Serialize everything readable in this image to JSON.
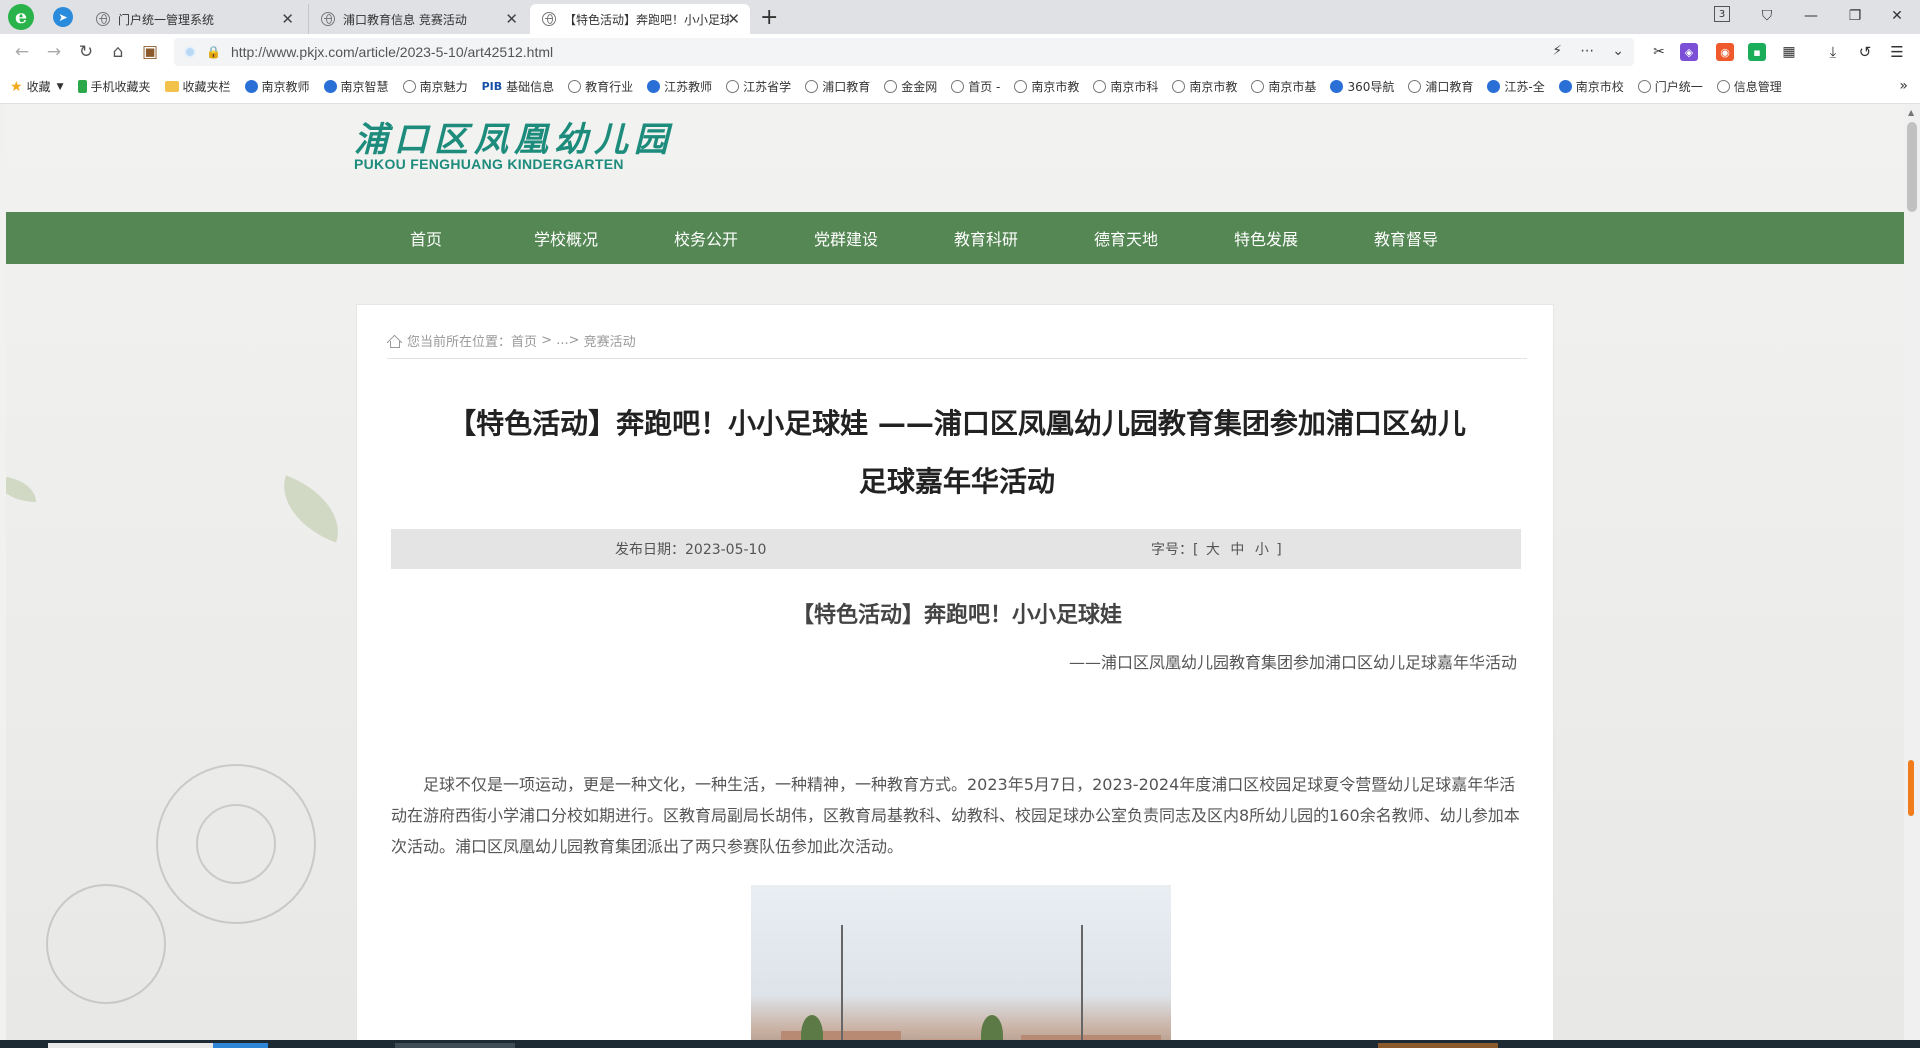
{
  "browser": {
    "tabs": [
      {
        "label": "门户统一管理系统",
        "active": false
      },
      {
        "label": "浦口教育信息 竞赛活动",
        "active": false
      },
      {
        "label": "【特色活动】奔跑吧！小小足球娃",
        "active": true
      }
    ],
    "tab_count_badge": "3",
    "url": "http://www.pkjx.com/article/2023-5-10/art42512.html",
    "bookmarks": [
      {
        "label": "收藏",
        "icon": "star-icon"
      },
      {
        "label": "手机收藏夹",
        "icon": "phone-icon"
      },
      {
        "label": "收藏夹栏",
        "icon": "folder-icon"
      },
      {
        "label": "南京教师",
        "icon": "site-icon"
      },
      {
        "label": "南京智慧",
        "icon": "site-icon"
      },
      {
        "label": "南京魅力",
        "icon": "globe-icon"
      },
      {
        "label": "基础信息",
        "icon": "pib-icon"
      },
      {
        "label": "教育行业",
        "icon": "globe-icon"
      },
      {
        "label": "江苏教师",
        "icon": "site-icon"
      },
      {
        "label": "江苏省学",
        "icon": "globe-icon"
      },
      {
        "label": "浦口教育",
        "icon": "globe-icon"
      },
      {
        "label": "金金网",
        "icon": "globe-icon"
      },
      {
        "label": "首页 -",
        "icon": "globe-icon"
      },
      {
        "label": "南京市教",
        "icon": "globe-icon"
      },
      {
        "label": "南京市科",
        "icon": "globe-icon"
      },
      {
        "label": "南京市教",
        "icon": "globe-icon"
      },
      {
        "label": "南京市基",
        "icon": "globe-icon"
      },
      {
        "label": "360导航",
        "icon": "site-icon"
      },
      {
        "label": "浦口教育",
        "icon": "globe-icon"
      },
      {
        "label": "江苏-全",
        "icon": "site-icon"
      },
      {
        "label": "南京市校",
        "icon": "site-icon"
      },
      {
        "label": "门户统一",
        "icon": "globe-icon"
      },
      {
        "label": "信息管理",
        "icon": "globe-icon"
      }
    ],
    "pib_text": "PIB"
  },
  "site": {
    "name_cn": "浦口区凤凰幼儿园",
    "name_en": "PUKOU FENGHUANG KINDERGARTEN",
    "nav": [
      "首页",
      "学校概况",
      "校务公开",
      "党群建设",
      "教育科研",
      "德育天地",
      "特色发展",
      "教育督导"
    ]
  },
  "breadcrumb": {
    "prefix": "您当前所在位置：",
    "home": "首页",
    "sep1": " > ",
    "ellipsis": "...",
    "sep2": "> ",
    "current": "竞赛活动"
  },
  "article": {
    "title_line1": "【特色活动】奔跑吧！小小足球娃 ——浦口区凤凰幼儿园教育集团参加浦口区幼儿",
    "title_line2": "足球嘉年华活动",
    "date_label": "发布日期：",
    "date": "2023-05-10",
    "font_label": "字号：",
    "font_open": "[",
    "font_large": "大",
    "font_medium": "中",
    "font_small": "小",
    "font_close": "]",
    "subtitle": "【特色活动】奔跑吧！小小足球娃",
    "subline": "——浦口区凤凰幼儿园教育集团参加浦口区幼儿足球嘉年华活动",
    "paragraph": "足球不仅是一项运动，更是一种文化，一种生活，一种精神，一种教育方式。2023年5月7日，2023-2024年度浦口区校园足球夏令营暨幼儿足球嘉年华活动在游府西街小学浦口分校如期进行。区教育局副局长胡伟，区教育局基教科、幼教科、校园足球办公室负责同志及区内8所幼儿园的160余名教师、幼儿参加本次活动。浦口区凤凰幼儿园教育集团派出了两只参赛队伍参加此次活动。"
  },
  "colors": {
    "nav_green": "#548753",
    "brand_teal": "#1d8c7c"
  }
}
